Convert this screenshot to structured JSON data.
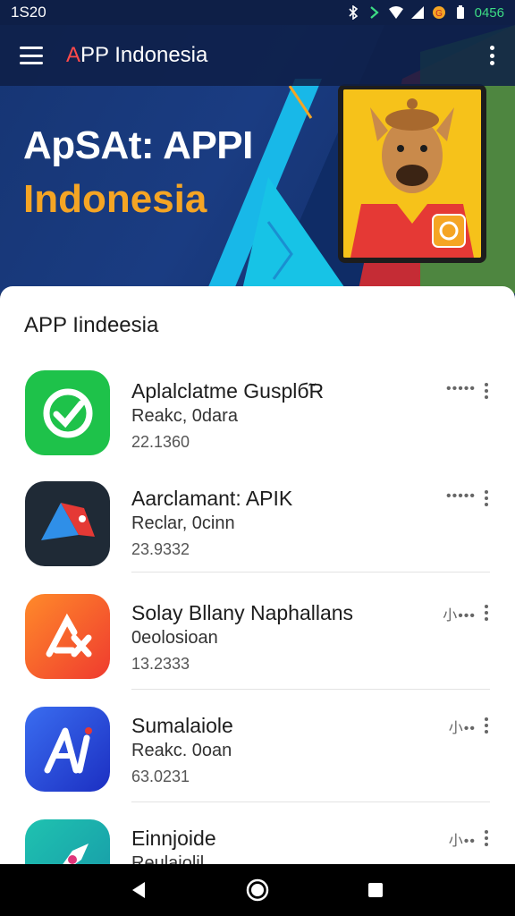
{
  "status_bar": {
    "time": "1S20",
    "right_text": "0456",
    "icons": [
      "bluetooth-icon",
      "signal-arrow-icon",
      "wifi-icon",
      "cell-signal-icon",
      "notification-icon",
      "battery-icon"
    ]
  },
  "app_bar": {
    "title_accent": "A",
    "title_rest": "PP Indonesia"
  },
  "hero": {
    "title": "ApSAt: APPI",
    "subtitle": "Indonesia"
  },
  "section": {
    "title": "APP Iindeesia"
  },
  "apps": [
    {
      "name": "Aplalclatme Gusplб̃R",
      "sub": "Reakc, 0dara",
      "num": "22.1360",
      "rating": "•••••",
      "icon": "green-check-icon",
      "color": "#1ec24a"
    },
    {
      "name": "Aarclamant: APIK",
      "sub": "Reclar, 0cinn",
      "num": "23.9332",
      "rating": "•••••",
      "icon": "tag-diamond-icon",
      "color": "#1f2a36"
    },
    {
      "name": "Solay Bllany Naphallans",
      "sub": "0eolosioan",
      "num": "13.2333",
      "rating": "小•••",
      "icon": "lx-logo-icon",
      "color": "#f2572a"
    },
    {
      "name": "Sumalaiole",
      "sub": "Reakc. 0oan",
      "num": "63.0231",
      "rating": "小••",
      "icon": "ai-logo-icon",
      "color": "#2446d6"
    },
    {
      "name": "Einnjoide",
      "sub": "Reulaiolil",
      "num": "",
      "rating": "小••",
      "icon": "rocket-icon",
      "color": "#18b6a8"
    }
  ],
  "colors": {
    "header_bg": "#0e1f47",
    "hero_accent": "#f5a524",
    "title_accent": "#ff4a4a"
  }
}
